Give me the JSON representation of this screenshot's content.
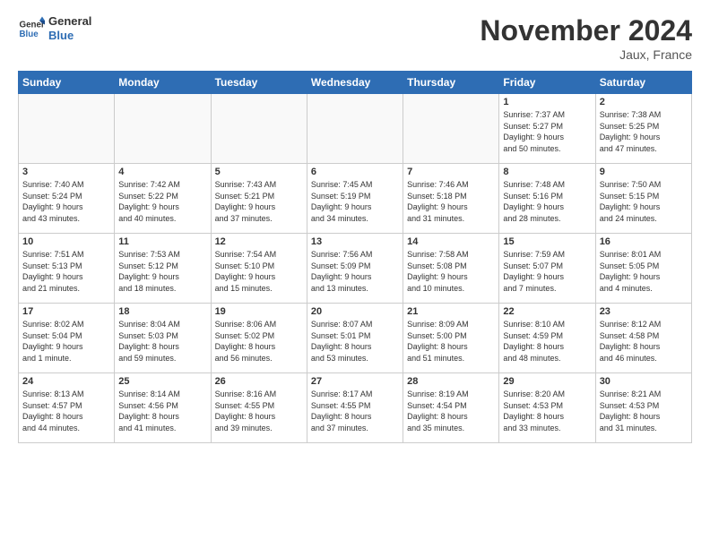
{
  "logo": {
    "line1": "General",
    "line2": "Blue"
  },
  "title": "November 2024",
  "location": "Jaux, France",
  "days_of_week": [
    "Sunday",
    "Monday",
    "Tuesday",
    "Wednesday",
    "Thursday",
    "Friday",
    "Saturday"
  ],
  "weeks": [
    [
      {
        "num": "",
        "info": ""
      },
      {
        "num": "",
        "info": ""
      },
      {
        "num": "",
        "info": ""
      },
      {
        "num": "",
        "info": ""
      },
      {
        "num": "",
        "info": ""
      },
      {
        "num": "1",
        "info": "Sunrise: 7:37 AM\nSunset: 5:27 PM\nDaylight: 9 hours\nand 50 minutes."
      },
      {
        "num": "2",
        "info": "Sunrise: 7:38 AM\nSunset: 5:25 PM\nDaylight: 9 hours\nand 47 minutes."
      }
    ],
    [
      {
        "num": "3",
        "info": "Sunrise: 7:40 AM\nSunset: 5:24 PM\nDaylight: 9 hours\nand 43 minutes."
      },
      {
        "num": "4",
        "info": "Sunrise: 7:42 AM\nSunset: 5:22 PM\nDaylight: 9 hours\nand 40 minutes."
      },
      {
        "num": "5",
        "info": "Sunrise: 7:43 AM\nSunset: 5:21 PM\nDaylight: 9 hours\nand 37 minutes."
      },
      {
        "num": "6",
        "info": "Sunrise: 7:45 AM\nSunset: 5:19 PM\nDaylight: 9 hours\nand 34 minutes."
      },
      {
        "num": "7",
        "info": "Sunrise: 7:46 AM\nSunset: 5:18 PM\nDaylight: 9 hours\nand 31 minutes."
      },
      {
        "num": "8",
        "info": "Sunrise: 7:48 AM\nSunset: 5:16 PM\nDaylight: 9 hours\nand 28 minutes."
      },
      {
        "num": "9",
        "info": "Sunrise: 7:50 AM\nSunset: 5:15 PM\nDaylight: 9 hours\nand 24 minutes."
      }
    ],
    [
      {
        "num": "10",
        "info": "Sunrise: 7:51 AM\nSunset: 5:13 PM\nDaylight: 9 hours\nand 21 minutes."
      },
      {
        "num": "11",
        "info": "Sunrise: 7:53 AM\nSunset: 5:12 PM\nDaylight: 9 hours\nand 18 minutes."
      },
      {
        "num": "12",
        "info": "Sunrise: 7:54 AM\nSunset: 5:10 PM\nDaylight: 9 hours\nand 15 minutes."
      },
      {
        "num": "13",
        "info": "Sunrise: 7:56 AM\nSunset: 5:09 PM\nDaylight: 9 hours\nand 13 minutes."
      },
      {
        "num": "14",
        "info": "Sunrise: 7:58 AM\nSunset: 5:08 PM\nDaylight: 9 hours\nand 10 minutes."
      },
      {
        "num": "15",
        "info": "Sunrise: 7:59 AM\nSunset: 5:07 PM\nDaylight: 9 hours\nand 7 minutes."
      },
      {
        "num": "16",
        "info": "Sunrise: 8:01 AM\nSunset: 5:05 PM\nDaylight: 9 hours\nand 4 minutes."
      }
    ],
    [
      {
        "num": "17",
        "info": "Sunrise: 8:02 AM\nSunset: 5:04 PM\nDaylight: 9 hours\nand 1 minute."
      },
      {
        "num": "18",
        "info": "Sunrise: 8:04 AM\nSunset: 5:03 PM\nDaylight: 8 hours\nand 59 minutes."
      },
      {
        "num": "19",
        "info": "Sunrise: 8:06 AM\nSunset: 5:02 PM\nDaylight: 8 hours\nand 56 minutes."
      },
      {
        "num": "20",
        "info": "Sunrise: 8:07 AM\nSunset: 5:01 PM\nDaylight: 8 hours\nand 53 minutes."
      },
      {
        "num": "21",
        "info": "Sunrise: 8:09 AM\nSunset: 5:00 PM\nDaylight: 8 hours\nand 51 minutes."
      },
      {
        "num": "22",
        "info": "Sunrise: 8:10 AM\nSunset: 4:59 PM\nDaylight: 8 hours\nand 48 minutes."
      },
      {
        "num": "23",
        "info": "Sunrise: 8:12 AM\nSunset: 4:58 PM\nDaylight: 8 hours\nand 46 minutes."
      }
    ],
    [
      {
        "num": "24",
        "info": "Sunrise: 8:13 AM\nSunset: 4:57 PM\nDaylight: 8 hours\nand 44 minutes."
      },
      {
        "num": "25",
        "info": "Sunrise: 8:14 AM\nSunset: 4:56 PM\nDaylight: 8 hours\nand 41 minutes."
      },
      {
        "num": "26",
        "info": "Sunrise: 8:16 AM\nSunset: 4:55 PM\nDaylight: 8 hours\nand 39 minutes."
      },
      {
        "num": "27",
        "info": "Sunrise: 8:17 AM\nSunset: 4:55 PM\nDaylight: 8 hours\nand 37 minutes."
      },
      {
        "num": "28",
        "info": "Sunrise: 8:19 AM\nSunset: 4:54 PM\nDaylight: 8 hours\nand 35 minutes."
      },
      {
        "num": "29",
        "info": "Sunrise: 8:20 AM\nSunset: 4:53 PM\nDaylight: 8 hours\nand 33 minutes."
      },
      {
        "num": "30",
        "info": "Sunrise: 8:21 AM\nSunset: 4:53 PM\nDaylight: 8 hours\nand 31 minutes."
      }
    ]
  ]
}
